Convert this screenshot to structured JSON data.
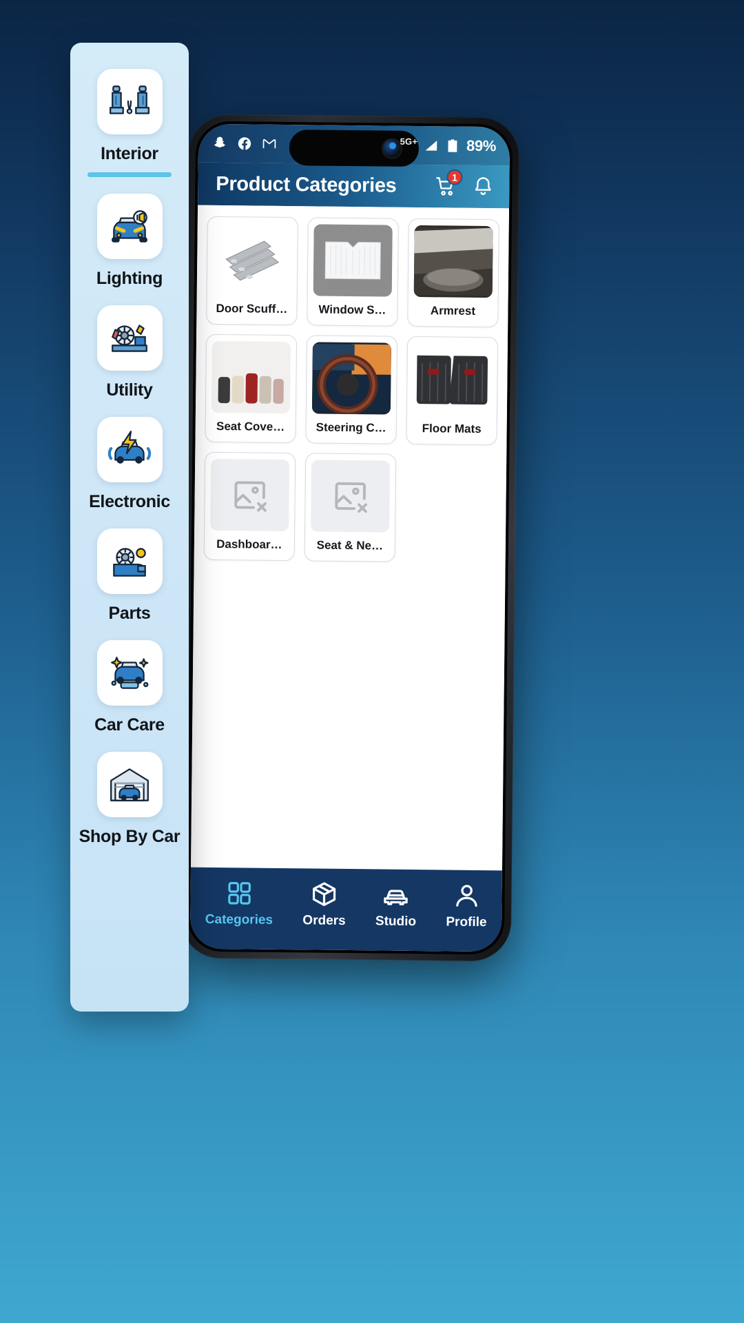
{
  "status_bar": {
    "left_icons": [
      {
        "name": "snapchat-icon"
      },
      {
        "name": "facebook-icon"
      },
      {
        "name": "gmail-icon"
      }
    ],
    "right_icons": [
      {
        "name": "alarm-clock-icon"
      },
      {
        "name": "wifi-calling-icon"
      },
      {
        "name": "data-transfer-icon"
      }
    ],
    "network_label": "5G+",
    "battery_label": "89%"
  },
  "app_bar": {
    "title": "Product Categories",
    "cart": {
      "icon": "shopping-cart-icon",
      "badge": "1"
    },
    "notifications": {
      "icon": "bell-icon"
    }
  },
  "products": [
    {
      "label": "Door Scuff…",
      "thumb": "door-scuff-plates"
    },
    {
      "label": "Window S…",
      "thumb": "window-sunshade"
    },
    {
      "label": "Armrest",
      "thumb": "armrest"
    },
    {
      "label": "Seat Cove…",
      "thumb": "seat-covers"
    },
    {
      "label": "Steering C…",
      "thumb": "steering-cover"
    },
    {
      "label": "Floor Mats",
      "thumb": "floor-mats"
    },
    {
      "label": "Dashboar…",
      "thumb": "broken-image"
    },
    {
      "label": "Seat & Ne…",
      "thumb": "broken-image"
    }
  ],
  "bottom_nav": [
    {
      "label": "Categories",
      "icon": "grid-icon",
      "active": true
    },
    {
      "label": "Orders",
      "icon": "box-icon",
      "active": false
    },
    {
      "label": "Studio",
      "icon": "car-icon",
      "active": false
    },
    {
      "label": "Profile",
      "icon": "person-icon",
      "active": false
    }
  ],
  "sidebar": {
    "items": [
      {
        "label": "Interior",
        "icon": "car-seats-icon",
        "selected": true
      },
      {
        "label": "Lighting",
        "icon": "car-headlight-icon",
        "selected": false
      },
      {
        "label": "Utility",
        "icon": "car-tools-icon",
        "selected": false
      },
      {
        "label": "Electronic",
        "icon": "car-electric-icon",
        "selected": false
      },
      {
        "label": "Parts",
        "icon": "engine-part-icon",
        "selected": false
      },
      {
        "label": "Car Care",
        "icon": "car-wash-icon",
        "selected": false
      },
      {
        "label": "Shop By Car",
        "icon": "garage-icon",
        "selected": false
      }
    ]
  },
  "colors": {
    "accent": "#5cc4e8",
    "header_dark": "#0f3761",
    "header_light": "#3a9ac2",
    "nav_bg": "#143764",
    "badge_red": "#e8372c",
    "sidebar_bg": "#d0e8f7"
  }
}
